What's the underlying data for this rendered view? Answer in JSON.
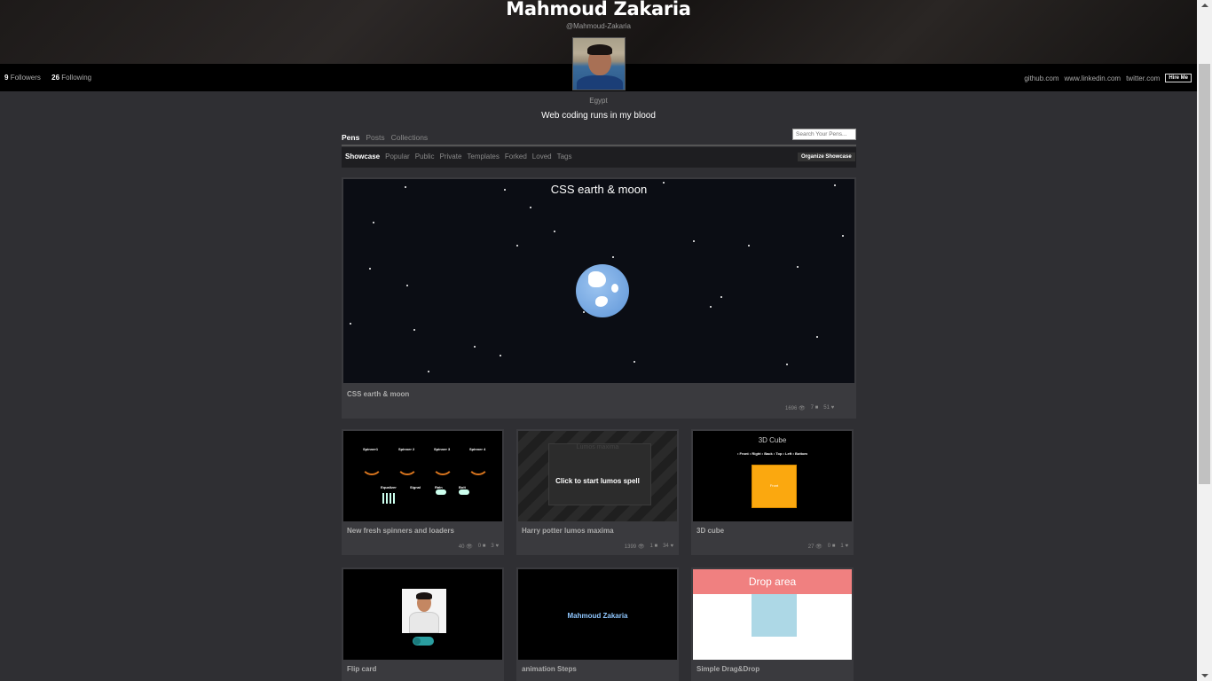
{
  "profile": {
    "name": "Mahmoud Zakaria",
    "handle": "@Mahmoud-Zakaria",
    "location": "Egypt",
    "bio": "Web coding runs in my blood",
    "followers_count": "9",
    "followers_label": "Followers",
    "following_count": "26",
    "following_label": "Following"
  },
  "links": [
    "github.com",
    "www.linkedin.com",
    "twitter.com"
  ],
  "hire_label": "Hire Me",
  "tabs": [
    "Pens",
    "Posts",
    "Collections"
  ],
  "search_placeholder": "Search Your Pens...",
  "subtabs": [
    "Showcase",
    "Popular",
    "Public",
    "Private",
    "Templates",
    "Forked",
    "Loved",
    "Tags"
  ],
  "organize_label": "Organize Showcase",
  "featured": {
    "heading": "CSS earth & moon",
    "title": "CSS earth & moon",
    "views": "1696",
    "comments": "7",
    "loves": "51"
  },
  "pens": [
    {
      "title": "New fresh spinners and loaders",
      "views": "40",
      "comments": "0",
      "loves": "3",
      "spinners": [
        "Spinner1",
        "Spinner 2",
        "Spinner 3",
        "Spinner 4"
      ],
      "loaders": [
        "Equalizer",
        "Signal",
        "Rain",
        "Bolt"
      ]
    },
    {
      "title": "Harry potter lumos maxima",
      "views": "1399",
      "comments": "1",
      "loves": "34",
      "inner_title": "Lumos maxima",
      "button": "Click to start lumos spell"
    },
    {
      "title": "3D cube",
      "views": "27",
      "comments": "0",
      "loves": "1",
      "inner_title": "3D Cube",
      "options": "• Front • Right • Back • Top • Left • Bottom",
      "face": "Front"
    },
    {
      "title": "Flip card"
    },
    {
      "title": "animation Steps",
      "inner_text": "Mahmoud Zakaria"
    },
    {
      "title": "Simple Drag&Drop",
      "drop_label": "Drop area"
    }
  ],
  "colors": {
    "accent_orange": "#fba80f",
    "drop_red": "#f08080",
    "drop_blue": "#add8e6"
  }
}
